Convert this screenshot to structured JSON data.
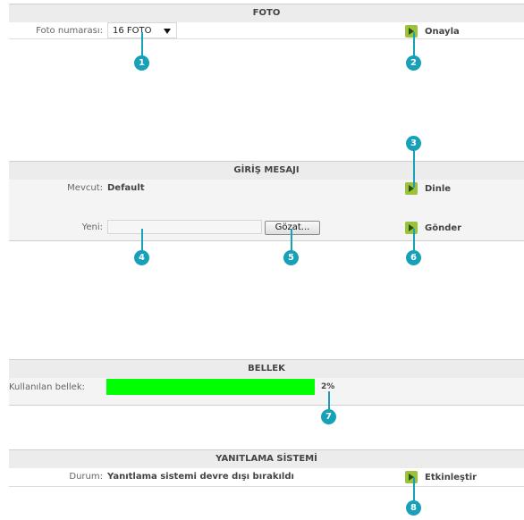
{
  "foto": {
    "title": "FOTO",
    "count_label": "Foto numarası:",
    "count_value": "16 FOTO",
    "confirm_label": "Onayla"
  },
  "greeting": {
    "title": "GİRİŞ MESAJI",
    "current_label": "Mevcut:",
    "current_value": "Default",
    "listen_label": "Dinle",
    "new_label": "Yeni:",
    "new_value": "",
    "browse_label": "Gözat...",
    "send_label": "Gönder"
  },
  "memory": {
    "title": "BELLEK",
    "used_label": "Kullanılan bellek:",
    "used_percent_text": "2%",
    "fill_color": "#00ff00"
  },
  "answering": {
    "title": "YANITLAMA SİSTEMİ",
    "status_label": "Durum:",
    "status_value": "Yanıtlama sistemi devre dışı bırakıldı",
    "enable_label": "Etkinleştir"
  },
  "callouts": [
    "1",
    "2",
    "3",
    "4",
    "5",
    "6",
    "7",
    "8"
  ],
  "accent_color": "#16a1b9"
}
